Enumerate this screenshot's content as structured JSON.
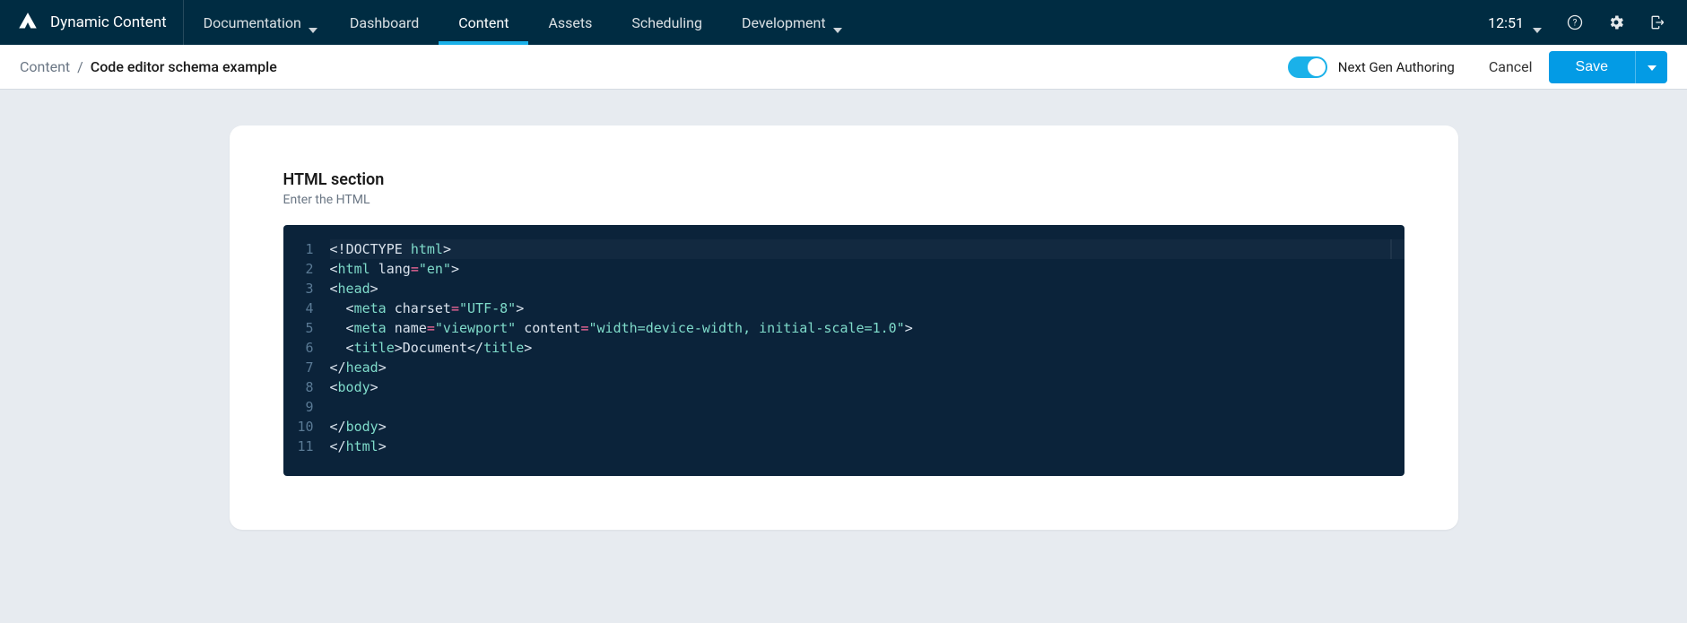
{
  "brand": "Dynamic Content",
  "nav": {
    "documentation": "Documentation",
    "dashboard": "Dashboard",
    "content": "Content",
    "assets": "Assets",
    "scheduling": "Scheduling",
    "development": "Development"
  },
  "clock": {
    "time": "12:51"
  },
  "breadcrumb": {
    "root": "Content",
    "sep": "/",
    "current": "Code editor schema example"
  },
  "authoring": {
    "toggle_label": "Next Gen Authoring",
    "enabled": true
  },
  "actions": {
    "cancel": "Cancel",
    "save": "Save"
  },
  "section": {
    "title": "HTML section",
    "subtitle": "Enter the HTML"
  },
  "editor": {
    "line_numbers": [
      "1",
      "2",
      "3",
      "4",
      "5",
      "6",
      "7",
      "8",
      "9",
      "10",
      "11"
    ],
    "lines": [
      [
        {
          "c": "t-punc",
          "v": "<!"
        },
        {
          "c": "t-doctype",
          "v": "DOCTYPE"
        },
        {
          "c": "t-punc",
          "v": " "
        },
        {
          "c": "t-tag",
          "v": "html"
        },
        {
          "c": "t-punc",
          "v": ">"
        }
      ],
      [
        {
          "c": "t-punc",
          "v": "<"
        },
        {
          "c": "t-tag",
          "v": "html"
        },
        {
          "c": "t-punc",
          "v": " "
        },
        {
          "c": "t-attr",
          "v": "lang"
        },
        {
          "c": "t-eq",
          "v": "="
        },
        {
          "c": "t-str",
          "v": "\"en\""
        },
        {
          "c": "t-punc",
          "v": ">"
        }
      ],
      [
        {
          "c": "t-punc",
          "v": "<"
        },
        {
          "c": "t-tag",
          "v": "head"
        },
        {
          "c": "t-punc",
          "v": ">"
        }
      ],
      [
        {
          "c": "t-punc",
          "v": "  <"
        },
        {
          "c": "t-tag",
          "v": "meta"
        },
        {
          "c": "t-punc",
          "v": " "
        },
        {
          "c": "t-attr",
          "v": "charset"
        },
        {
          "c": "t-eq",
          "v": "="
        },
        {
          "c": "t-str",
          "v": "\"UTF-8\""
        },
        {
          "c": "t-punc",
          "v": ">"
        }
      ],
      [
        {
          "c": "t-punc",
          "v": "  <"
        },
        {
          "c": "t-tag",
          "v": "meta"
        },
        {
          "c": "t-punc",
          "v": " "
        },
        {
          "c": "t-attr",
          "v": "name"
        },
        {
          "c": "t-eq",
          "v": "="
        },
        {
          "c": "t-str",
          "v": "\"viewport\""
        },
        {
          "c": "t-punc",
          "v": " "
        },
        {
          "c": "t-attr",
          "v": "content"
        },
        {
          "c": "t-eq",
          "v": "="
        },
        {
          "c": "t-str",
          "v": "\"width=device-width, initial-scale=1.0\""
        },
        {
          "c": "t-punc",
          "v": ">"
        }
      ],
      [
        {
          "c": "t-punc",
          "v": "  <"
        },
        {
          "c": "t-tag",
          "v": "title"
        },
        {
          "c": "t-punc",
          "v": ">"
        },
        {
          "c": "t-text",
          "v": "Document"
        },
        {
          "c": "t-punc",
          "v": "</"
        },
        {
          "c": "t-tag",
          "v": "title"
        },
        {
          "c": "t-punc",
          "v": ">"
        }
      ],
      [
        {
          "c": "t-punc",
          "v": "</"
        },
        {
          "c": "t-tag",
          "v": "head"
        },
        {
          "c": "t-punc",
          "v": ">"
        }
      ],
      [
        {
          "c": "t-punc",
          "v": "<"
        },
        {
          "c": "t-tag",
          "v": "body"
        },
        {
          "c": "t-punc",
          "v": ">"
        }
      ],
      [],
      [
        {
          "c": "t-punc",
          "v": "</"
        },
        {
          "c": "t-tag",
          "v": "body"
        },
        {
          "c": "t-punc",
          "v": ">"
        }
      ],
      [
        {
          "c": "t-punc",
          "v": "</"
        },
        {
          "c": "t-tag",
          "v": "html"
        },
        {
          "c": "t-punc",
          "v": ">"
        }
      ]
    ]
  }
}
